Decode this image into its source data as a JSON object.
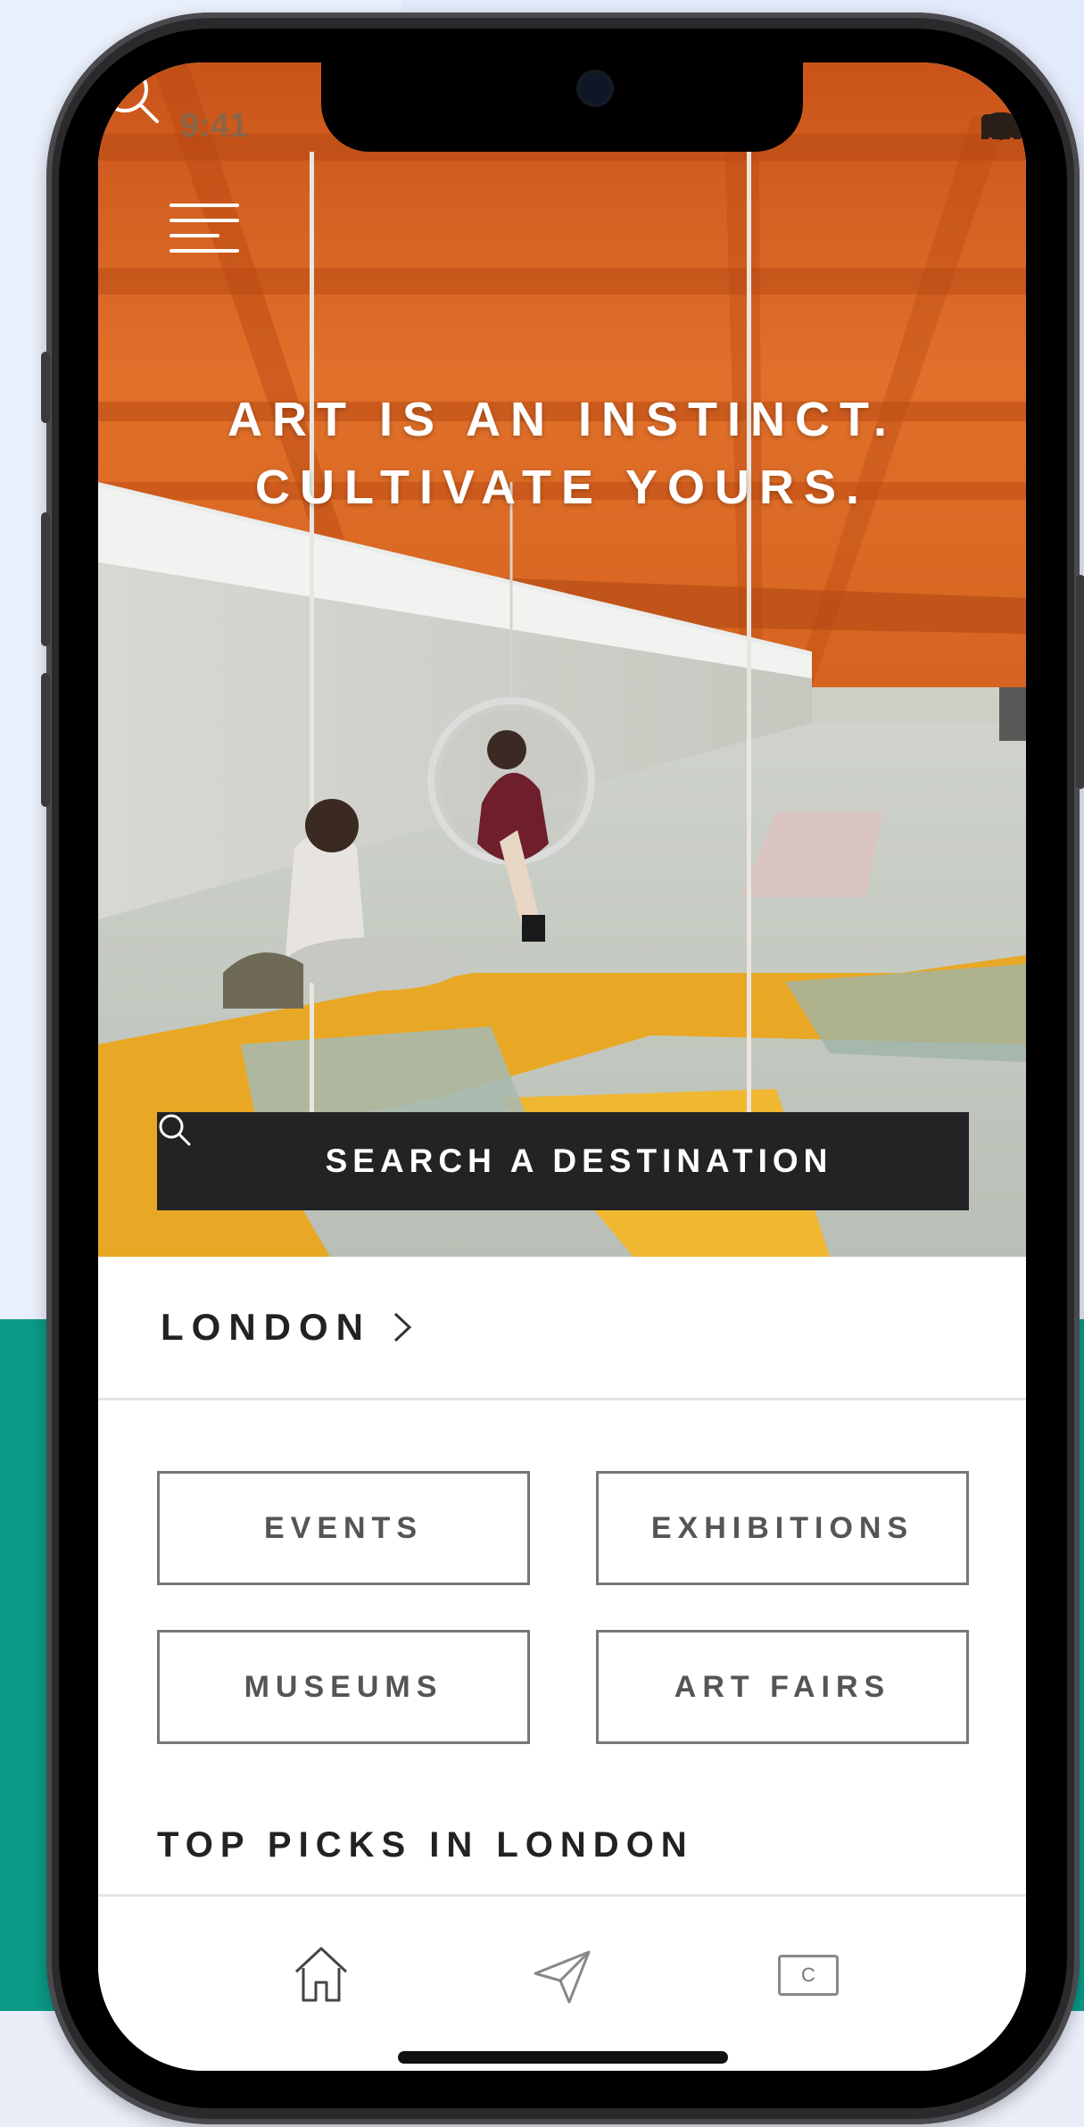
{
  "status_bar": {
    "time": "9:41"
  },
  "hero": {
    "headline_line1": "ART IS AN INSTINCT.",
    "headline_line2": "CULTIVATE YOURS.",
    "search_label": "SEARCH A DESTINATION",
    "menu_icon": "menu-icon",
    "search_icon": "search-icon"
  },
  "location": {
    "city": "LONDON",
    "icon": "chevron-right-icon"
  },
  "categories": [
    {
      "label": "EVENTS"
    },
    {
      "label": "EXHIBITIONS"
    },
    {
      "label": "MUSEUMS"
    },
    {
      "label": "ART FAIRS"
    }
  ],
  "section": {
    "title": "TOP PICKS IN LONDON"
  },
  "tabbar": {
    "tabs": [
      {
        "icon": "home-icon"
      },
      {
        "icon": "send-icon"
      },
      {
        "icon": "card-icon",
        "label": "C"
      }
    ]
  },
  "colors": {
    "accent_teal": "#0a9a86",
    "search_bar": "#232325",
    "ceiling_orange": "#d9611c",
    "floor_yellow": "#e8a825"
  }
}
